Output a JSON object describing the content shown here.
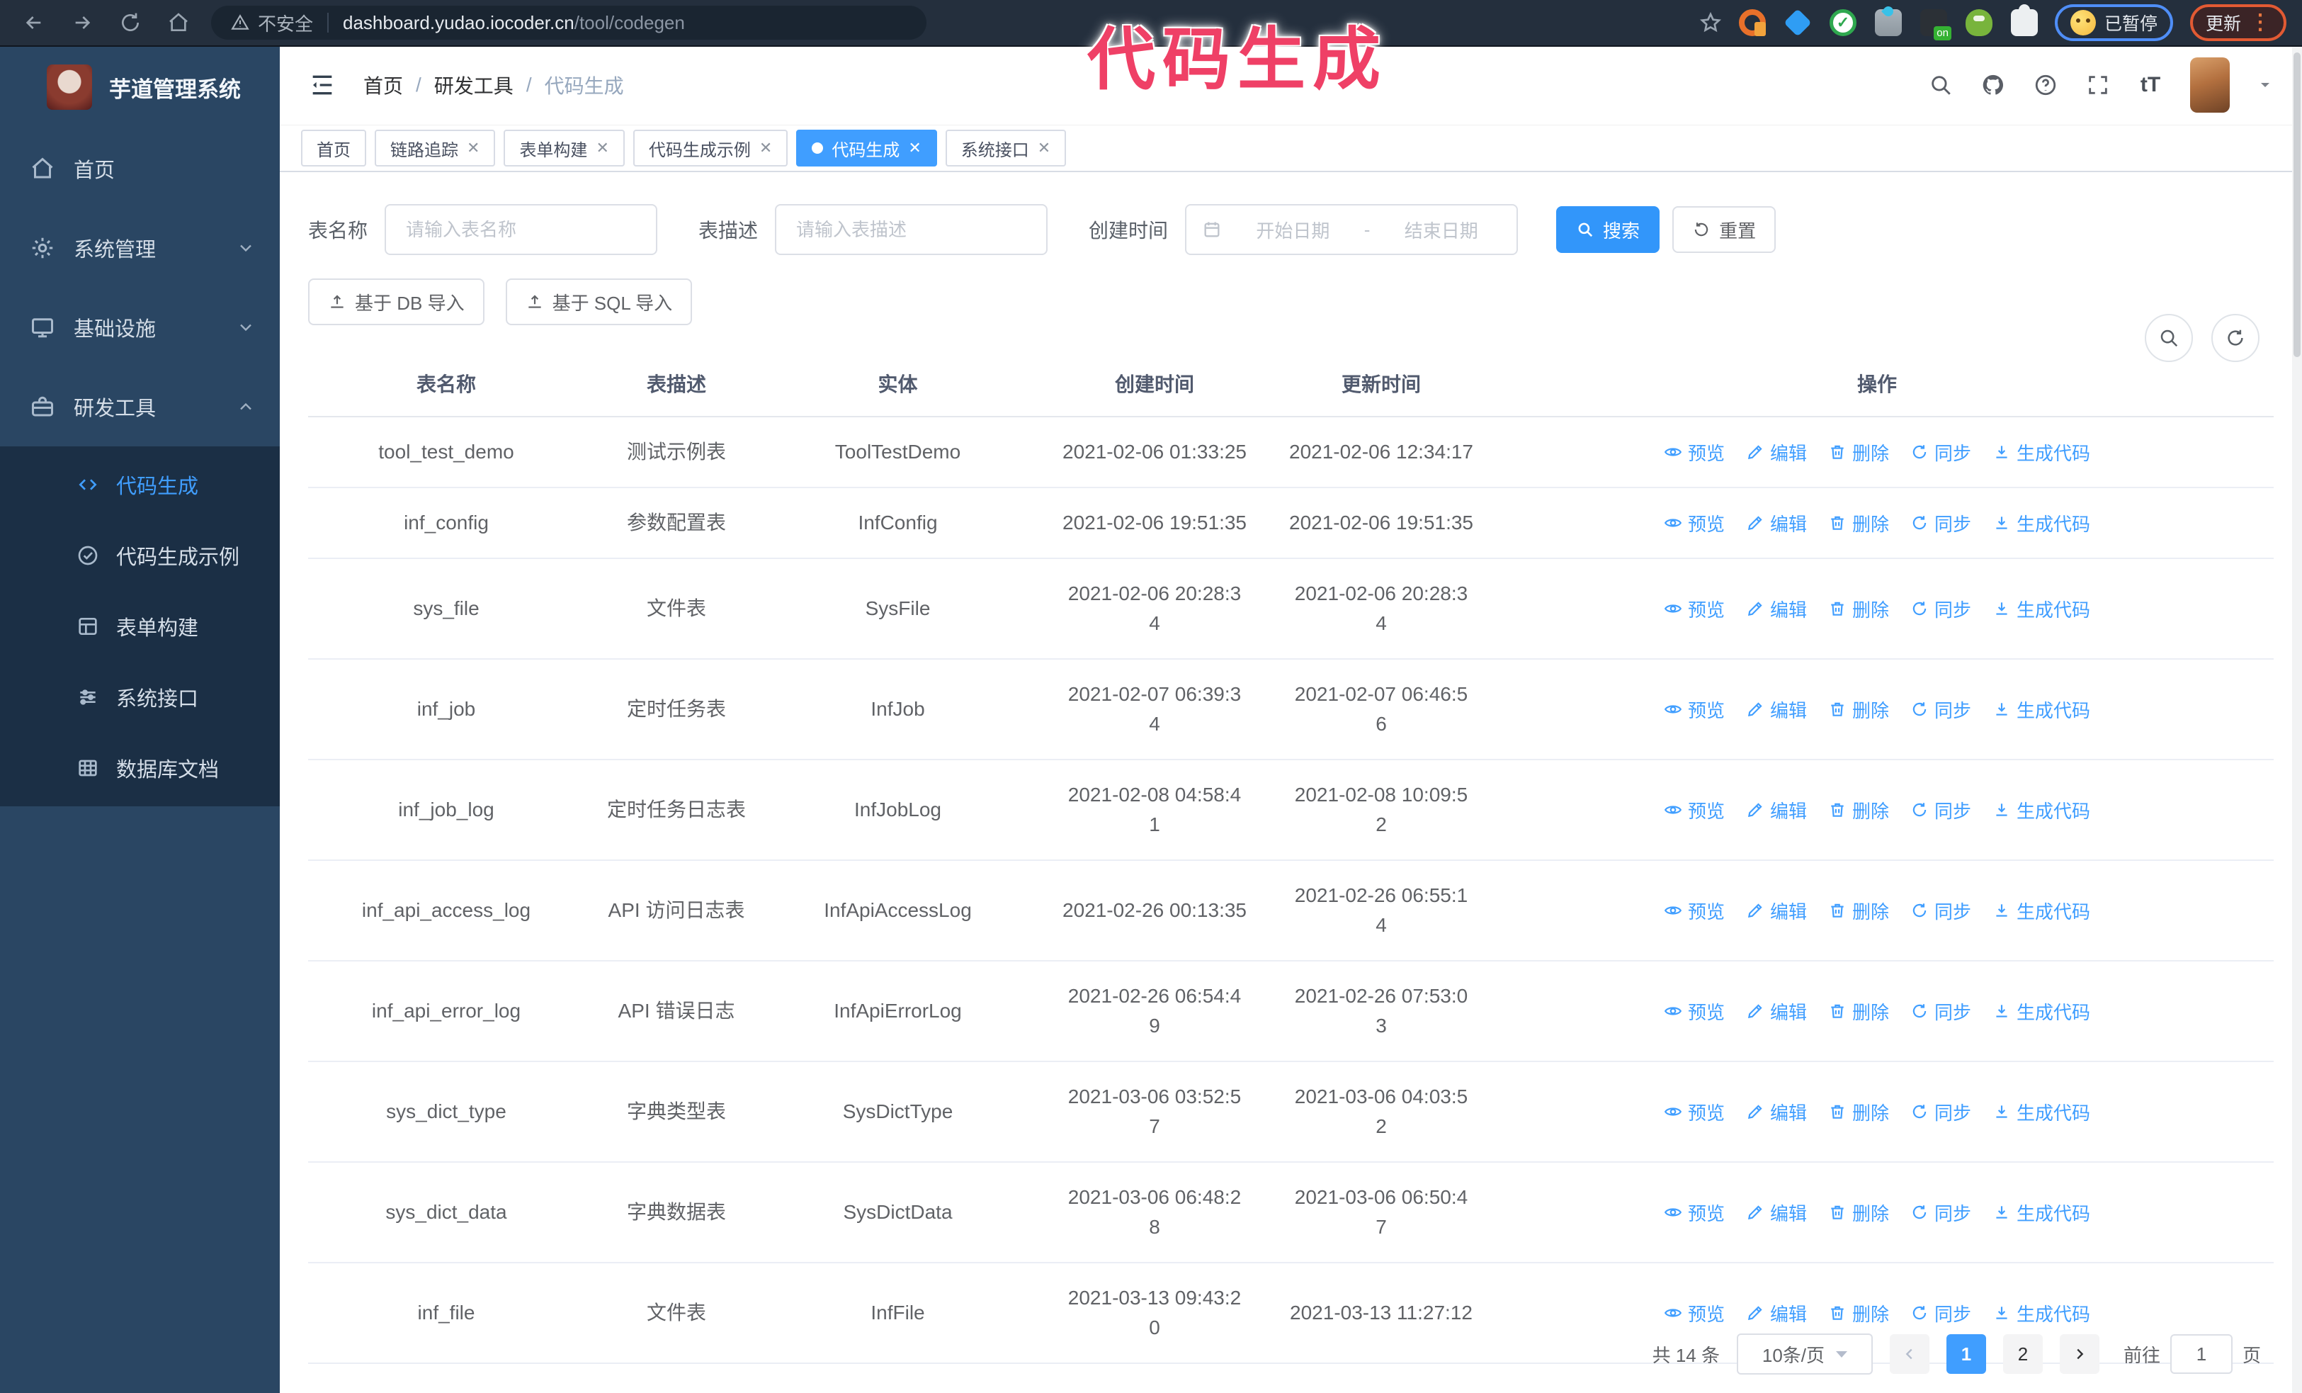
{
  "overlay": {
    "title": "代码生成"
  },
  "browser": {
    "insecure_label": "不安全",
    "url_host": "dashboard.yudao.iocoder.cn",
    "url_path": "/tool/codegen",
    "profile_status": "已暂停",
    "update_label": "更新",
    "extensions": [
      {
        "name": "refresh-orange-ext-icon"
      },
      {
        "name": "gem-blue-ext-icon"
      },
      {
        "name": "shield-check-ext-icon"
      },
      {
        "name": "grid-gray-ext-icon"
      },
      {
        "name": "on-badge-ext-icon"
      },
      {
        "name": "robot-green-ext-icon"
      },
      {
        "name": "puzzle-ext-icon"
      }
    ]
  },
  "sidebar": {
    "app_title": "芋道管理系统",
    "items": [
      {
        "label": "首页",
        "icon": "home",
        "chevron": "",
        "active": false
      },
      {
        "label": "系统管理",
        "icon": "gear",
        "chevron": "down",
        "active": false
      },
      {
        "label": "基础设施",
        "icon": "monitor",
        "chevron": "down",
        "active": false
      },
      {
        "label": "研发工具",
        "icon": "toolbox",
        "chevron": "up",
        "active": false
      }
    ],
    "subitems": [
      {
        "label": "代码生成",
        "icon": "code",
        "active": true
      },
      {
        "label": "代码生成示例",
        "icon": "example",
        "active": false
      },
      {
        "label": "表单构建",
        "icon": "form",
        "active": false
      },
      {
        "label": "系统接口",
        "icon": "api",
        "active": false
      },
      {
        "label": "数据库文档",
        "icon": "database",
        "active": false
      }
    ]
  },
  "header": {
    "breadcrumb": {
      "home": "首页",
      "section": "研发工具",
      "current": "代码生成",
      "separator": "/"
    }
  },
  "tabs": [
    {
      "label": "首页",
      "closable": false,
      "active": false
    },
    {
      "label": "链路追踪",
      "closable": true,
      "active": false
    },
    {
      "label": "表单构建",
      "closable": true,
      "active": false
    },
    {
      "label": "代码生成示例",
      "closable": true,
      "active": false
    },
    {
      "label": "代码生成",
      "closable": true,
      "active": true
    },
    {
      "label": "系统接口",
      "closable": true,
      "active": false
    }
  ],
  "filters": {
    "table_name_label": "表名称",
    "table_name_placeholder": "请输入表名称",
    "table_desc_label": "表描述",
    "table_desc_placeholder": "请输入表描述",
    "create_time_label": "创建时间",
    "start_placeholder": "开始日期",
    "range_separator": "-",
    "end_placeholder": "结束日期",
    "search_label": "搜索",
    "reset_label": "重置"
  },
  "toolbar": {
    "import_db_label": "基于 DB 导入",
    "import_sql_label": "基于 SQL 导入"
  },
  "table": {
    "columns": [
      "表名称",
      "表描述",
      "实体",
      "创建时间",
      "更新时间",
      "操作"
    ],
    "actions": [
      {
        "name": "preview",
        "label": "预览",
        "icon": "eye"
      },
      {
        "name": "edit",
        "label": "编辑",
        "icon": "edit"
      },
      {
        "name": "delete",
        "label": "删除",
        "icon": "trash"
      },
      {
        "name": "sync",
        "label": "同步",
        "icon": "sync"
      },
      {
        "name": "generate",
        "label": "生成代码",
        "icon": "download"
      }
    ],
    "rows": [
      {
        "name": "tool_test_demo",
        "desc": "测试示例表",
        "entity": "ToolTestDemo",
        "created": "2021-02-06 01:33:25",
        "updated": "2021-02-06 12:34:17"
      },
      {
        "name": "inf_config",
        "desc": "参数配置表",
        "entity": "InfConfig",
        "created": "2021-02-06 19:51:35",
        "updated": "2021-02-06 19:51:35"
      },
      {
        "name": "sys_file",
        "desc": "文件表",
        "entity": "SysFile",
        "created": "2021-02-06 20:28:3\n4",
        "updated": "2021-02-06 20:28:3\n4"
      },
      {
        "name": "inf_job",
        "desc": "定时任务表",
        "entity": "InfJob",
        "created": "2021-02-07 06:39:3\n4",
        "updated": "2021-02-07 06:46:5\n6"
      },
      {
        "name": "inf_job_log",
        "desc": "定时任务日志表",
        "entity": "InfJobLog",
        "created": "2021-02-08 04:58:4\n1",
        "updated": "2021-02-08 10:09:5\n2"
      },
      {
        "name": "inf_api_access_log",
        "desc": "API 访问日志表",
        "entity": "InfApiAccessLog",
        "created": "2021-02-26 00:13:35",
        "updated": "2021-02-26 06:55:1\n4"
      },
      {
        "name": "inf_api_error_log",
        "desc": "API 错误日志",
        "entity": "InfApiErrorLog",
        "created": "2021-02-26 06:54:4\n9",
        "updated": "2021-02-26 07:53:0\n3"
      },
      {
        "name": "sys_dict_type",
        "desc": "字典类型表",
        "entity": "SysDictType",
        "created": "2021-03-06 03:52:5\n7",
        "updated": "2021-03-06 04:03:5\n2"
      },
      {
        "name": "sys_dict_data",
        "desc": "字典数据表",
        "entity": "SysDictData",
        "created": "2021-03-06 06:48:2\n8",
        "updated": "2021-03-06 06:50:4\n7"
      },
      {
        "name": "inf_file",
        "desc": "文件表",
        "entity": "InfFile",
        "created": "2021-03-13 09:43:2\n0",
        "updated": "2021-03-13 11:27:12"
      }
    ]
  },
  "pagination": {
    "total_label": "共 14 条",
    "page_size": "10条/页",
    "pages": [
      "1",
      "2"
    ],
    "active_page": "1",
    "goto_label": "前往",
    "goto_value": "1",
    "page_suffix": "页"
  },
  "colors": {
    "accent": "#409eff",
    "sidebar_bg": "#2a4663",
    "submenu_bg": "#1b2f45",
    "chrome_bg": "#242f3d",
    "annotation": "#ef4066"
  }
}
